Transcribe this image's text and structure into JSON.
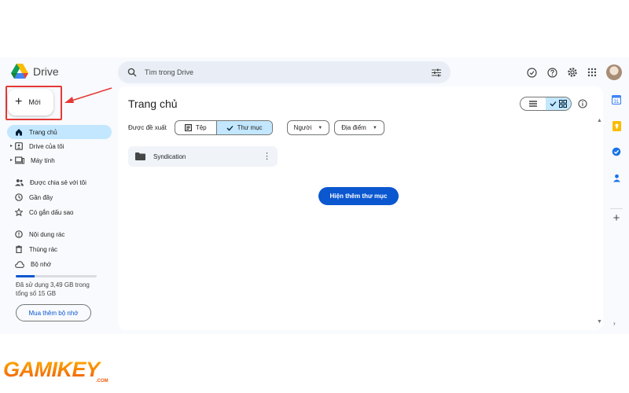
{
  "header": {
    "app_name": "Drive",
    "search_placeholder": "Tìm trong Drive"
  },
  "new_button": {
    "label": "Mới"
  },
  "nav": {
    "home": "Trang chủ",
    "my_drive": "Drive của tôi",
    "computers": "Máy tính",
    "shared": "Được chia sẻ với tôi",
    "recent": "Gần đây",
    "starred": "Có gắn dấu sao",
    "spam": "Nội dung rác",
    "trash": "Thùng rác",
    "storage": "Bộ nhớ"
  },
  "storage": {
    "used_text": "Đã sử dụng 3,49 GB trong tổng số 15 GB",
    "used_fraction": 0.233,
    "buy_label": "Mua thêm bộ nhớ"
  },
  "main": {
    "title": "Trang chủ",
    "suggested_label": "Được đề xuất",
    "tab_files": "Tệp",
    "tab_folders": "Thư mục",
    "filter_people": "Người",
    "filter_location": "Địa điểm",
    "folder_name": "Syndication",
    "show_more": "Hiện thêm thư mục"
  },
  "colors": {
    "accent": "#0b57d0",
    "selected": "#c2e7ff",
    "highlight": "#e53935"
  },
  "watermark": {
    "brand": "GAMIKEY",
    "suffix": ".COM"
  }
}
